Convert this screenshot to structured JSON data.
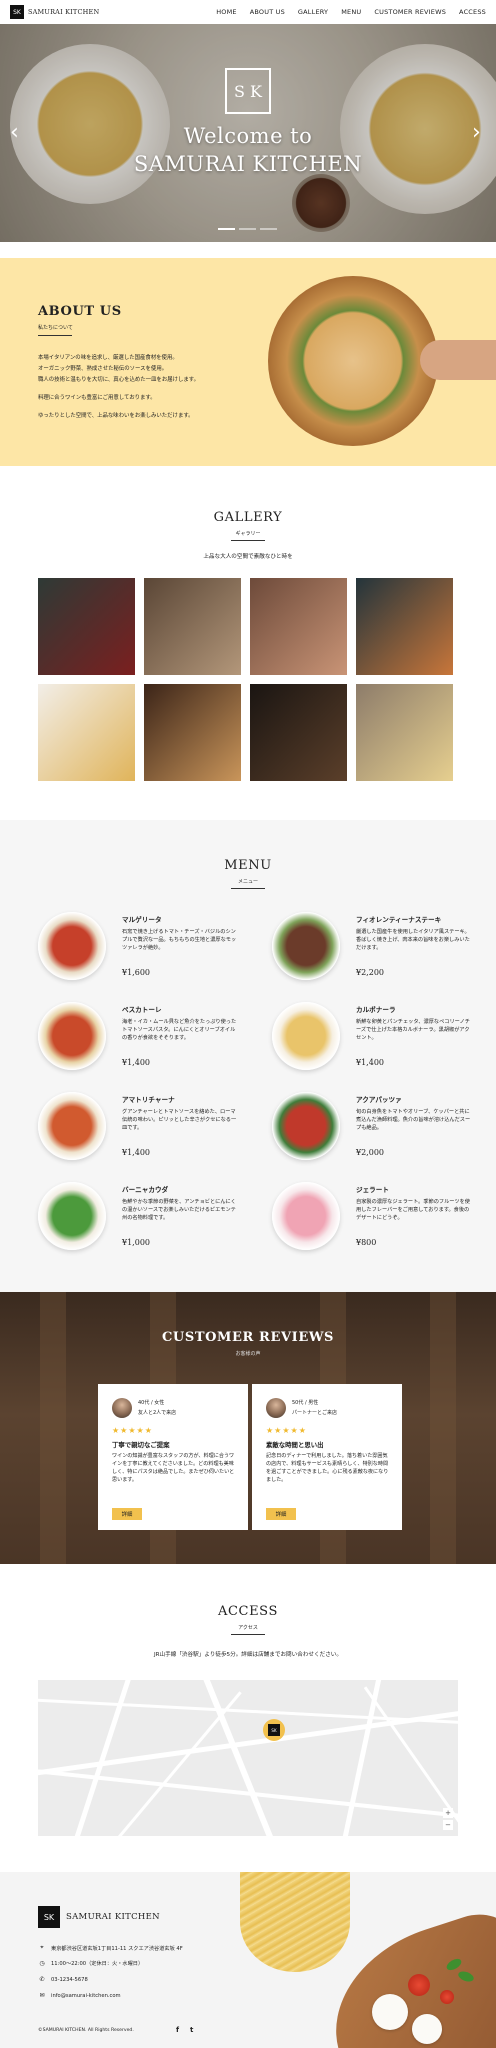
{
  "header": {
    "brand": "SAMURAI KITCHEN",
    "logo_text": "SK",
    "nav": [
      "HOME",
      "ABOUT US",
      "GALLERY",
      "MENU",
      "CUSTOMER REVIEWS",
      "ACCESS"
    ]
  },
  "hero": {
    "logo_text": "S K",
    "title_line1": "Welcome to",
    "title_line2": "SAMURAI KITCHEN",
    "prev_icon": "chevron-left-icon",
    "next_icon": "chevron-right-icon",
    "slide_count": 3,
    "active_slide": 1
  },
  "about": {
    "title": "ABOUT US",
    "subtitle": "私たちについて",
    "paragraphs": [
      "本場イタリアンの味を追求し、厳選した国産食材を使用。",
      "オーガニック野菜、熟成させた秘伝のソースを使用。",
      "職人の技術と温もりを大切に、真心を込めた一皿をお届けします。",
      "料理に合うワインも豊富にご用意しております。",
      "ゆったりとした空間で、上品な味わいをお楽しみいただけます。"
    ]
  },
  "gallery": {
    "title": "GALLERY",
    "subtitle": "ギャラリー",
    "description": "上品な大人の空間で素敵なひと時を",
    "tiles": [
      {
        "name": "gallery-terrace",
        "colors": [
          "#2e3a36",
          "#7b1f1f"
        ]
      },
      {
        "name": "gallery-kitchen",
        "colors": [
          "#5a4636",
          "#b3977a"
        ]
      },
      {
        "name": "gallery-dinner",
        "colors": [
          "#6d4a3a",
          "#c99476"
        ]
      },
      {
        "name": "gallery-dishes",
        "colors": [
          "#23343b",
          "#c8763a"
        ]
      },
      {
        "name": "gallery-pasta",
        "colors": [
          "#f2eee8",
          "#e0b45a"
        ]
      },
      {
        "name": "gallery-tiramisu",
        "colors": [
          "#3b2418",
          "#c9955a"
        ]
      },
      {
        "name": "gallery-bar",
        "colors": [
          "#1a1512",
          "#5b3f2a"
        ]
      },
      {
        "name": "gallery-cheese",
        "colors": [
          "#8d7c6a",
          "#e6cf8f"
        ]
      }
    ]
  },
  "menu": {
    "title": "MENU",
    "subtitle": "メニュー",
    "items": [
      {
        "name": "マルゲリータ",
        "desc": "石窯で焼き上げるトマト・チーズ・バジルのシンプルで贅沢な一品。もちもちの生地と濃厚なモッツァレラが絶妙。",
        "price": "¥1,600",
        "colors": [
          "#c6402a",
          "#e9dcc6"
        ]
      },
      {
        "name": "フィオレンティーナステーキ",
        "desc": "厳選した国産牛を使用したイタリア風ステーキ。香ばしく焼き上げ、肉本来の旨味をお楽しみいただけます。",
        "price": "¥2,200",
        "colors": [
          "#6b3b2a",
          "#7fa35a"
        ]
      },
      {
        "name": "ペスカトーレ",
        "desc": "海老・イカ・ムール貝など魚介をたっぷり使ったトマトソースパスタ。にんにくとオリーブオイルの香りが食欲をそそります。",
        "price": "¥1,400",
        "colors": [
          "#c94a2a",
          "#e8d3a6"
        ]
      },
      {
        "name": "カルボナーラ",
        "desc": "新鮮な卵黄とパンチェッタ、濃厚なペコリーノチーズで仕上げた本格カルボナーラ。黒胡椒がアクセント。",
        "price": "¥1,400",
        "colors": [
          "#e9c46a",
          "#f6efe1"
        ]
      },
      {
        "name": "アマトリチャーナ",
        "desc": "グアンチャーレとトマトソースを絡めた、ローマ伝統の味わい。ピリッとした辛さがクセになる一皿です。",
        "price": "¥1,400",
        "colors": [
          "#d15a2f",
          "#efe3cd"
        ]
      },
      {
        "name": "アクアパッツァ",
        "desc": "旬の白身魚をトマトやオリーブ、ケッパーと共に煮込んだ漁師料理。魚介の旨味が溶け込んだスープも絶品。",
        "price": "¥2,000",
        "colors": [
          "#c0392b",
          "#3f7d3a"
        ]
      },
      {
        "name": "バーニャカウダ",
        "desc": "色鮮やかな季節の野菜を、アンチョビとにんにくの温かいソースでお楽しみいただけるピエモンテ州の名物料理です。",
        "price": "¥1,000",
        "colors": [
          "#4c9a3c",
          "#f2ede2"
        ]
      },
      {
        "name": "ジェラート",
        "desc": "自家製の濃厚なジェラート。季節のフルーツを使用したフレーバーをご用意しております。食後のデザートにどうぞ。",
        "price": "¥800",
        "colors": [
          "#f0a4b4",
          "#f7e7ea"
        ]
      }
    ]
  },
  "reviews": {
    "title": "CUSTOMER REVIEWS",
    "subtitle": "お客様の声",
    "stars": "★★★★★",
    "items": [
      {
        "meta1": "40代 / 女性",
        "meta2": "友人と2人で来店",
        "title": "丁寧で親切なご提案",
        "text": "ワインの知識が豊富なスタッフの方が、料理に合うワインを丁寧に教えてくださいました。どの料理も美味しく、特にパスタは絶品でした。またぜひ伺いたいと思います。",
        "button": "詳細"
      },
      {
        "meta1": "50代 / 男性",
        "meta2": "パートナーとご来店",
        "title": "素敵な時間と思い出",
        "text": "記念日のディナーで利用しました。落ち着いた雰囲気の店内で、料理もサービスも素晴らしく、特別な時間を過ごすことができました。心に残る素敵な夜になりました。",
        "button": "詳細"
      }
    ]
  },
  "access": {
    "title": "ACCESS",
    "subtitle": "アクセス",
    "description": "JR山手線「渋谷駅」より徒歩5分。詳細は店舗までお問い合わせください。",
    "map_pin_text": "SK",
    "zoom_in": "+",
    "zoom_out": "−"
  },
  "footer": {
    "logo_text": "SK",
    "brand": "SAMURAI KITCHEN",
    "address": "東京都渋谷区道玄坂1丁目11-11 スクエア渋谷道玄坂 4F",
    "hours": "11:00〜22:00（定休日：火・水曜日）",
    "phone": "03-1234-5678",
    "email": "info@samurai-kitchen.com",
    "copyright": "©SAMURAI KITCHEN. All Rights Reserved.",
    "social": [
      "f",
      "t"
    ]
  }
}
